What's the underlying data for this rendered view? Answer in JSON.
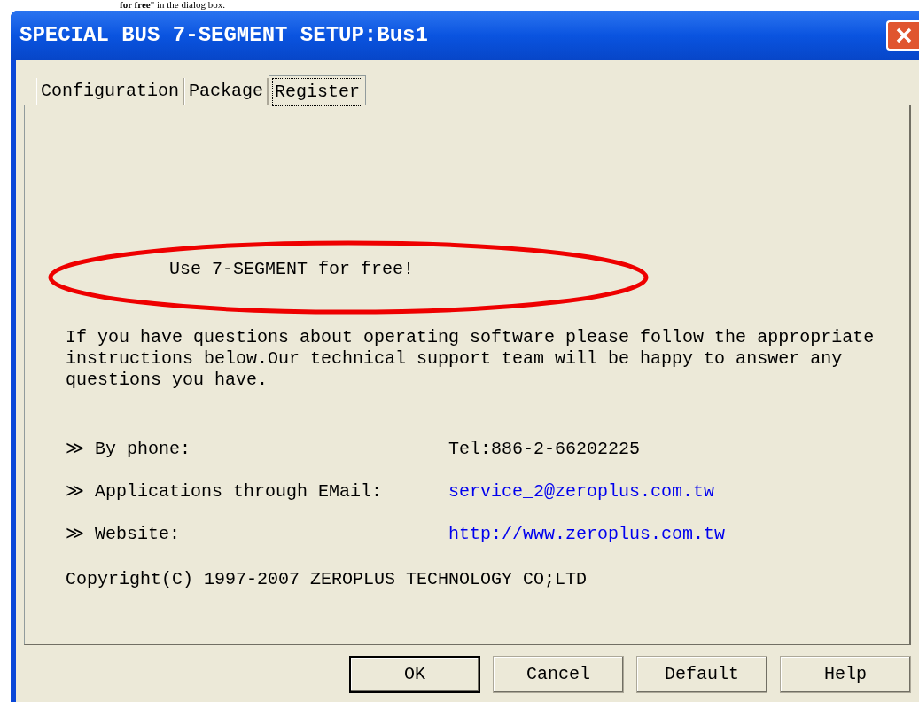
{
  "doc_text": "**for free**\" in the dialog box.",
  "window": {
    "title": "SPECIAL BUS 7-SEGMENT SETUP:Bus1"
  },
  "tabs": [
    {
      "label": "Configuration",
      "selected": false
    },
    {
      "label": "Package",
      "selected": false
    },
    {
      "label": "Register",
      "selected": true
    }
  ],
  "register": {
    "headline": "Use 7-SEGMENT for free!",
    "highlighted": true,
    "intro": "If you have questions about operating software please follow the appropriate instructions below.Our technical support team will be happy to answer any questions you have.",
    "contacts": [
      {
        "label": "≫ By phone:",
        "value": "Tel:886-2-66202225",
        "kind": "text"
      },
      {
        "label": "≫ Applications through EMail:",
        "value": "service_2@zeroplus.com.tw",
        "kind": "link"
      },
      {
        "label": "≫ Website:",
        "value": "http://www.zeroplus.com.tw",
        "kind": "link"
      }
    ],
    "copyright": "Copyright(C) 1997-2007 ZEROPLUS TECHNOLOGY CO;LTD"
  },
  "buttons": [
    {
      "label": "OK",
      "default": true
    },
    {
      "label": "Cancel",
      "default": false
    },
    {
      "label": "Default",
      "default": false
    },
    {
      "label": "Help",
      "default": false
    }
  ]
}
